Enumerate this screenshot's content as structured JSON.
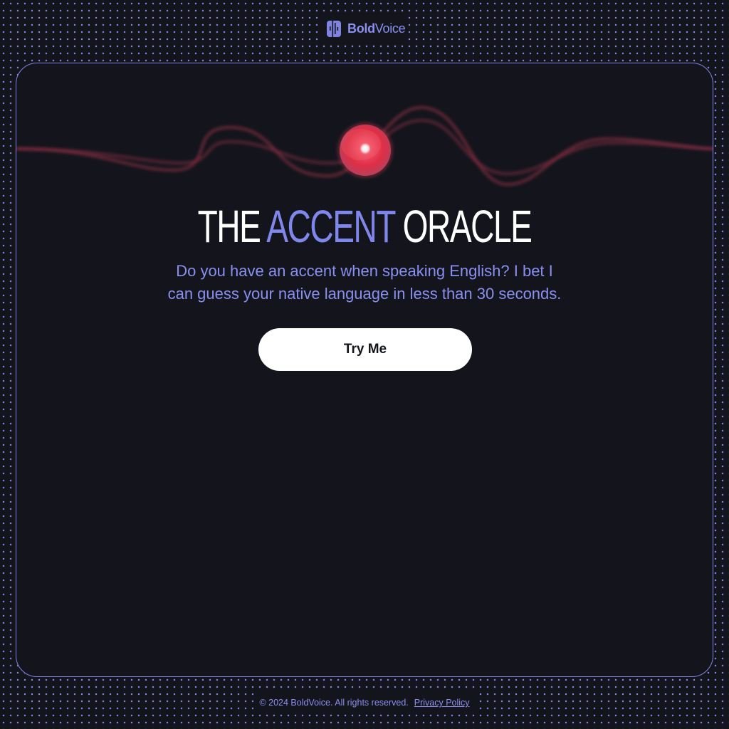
{
  "brand": {
    "name_bold": "Bold",
    "name_regular": "Voice",
    "logo_icon": "boldvoice-logo-icon",
    "color": "#8a8ff0"
  },
  "hero": {
    "title_part1": "THE",
    "title_accent": "ACCENT",
    "title_part2": "ORACLE",
    "subtitle_line1": "Do you have an accent when speaking English? I bet I",
    "subtitle_line2": "can guess your native language in less than 30 seconds.",
    "cta_label": "Try Me",
    "orb_icon": "glowing-orb-icon"
  },
  "footer": {
    "copyright": "© 2024 BoldVoice. All rights reserved.",
    "privacy_link": "Privacy Policy"
  },
  "colors": {
    "background": "#14151c",
    "accent": "#8087ec",
    "orb": "#e3344c",
    "wave": "#a83a55"
  }
}
